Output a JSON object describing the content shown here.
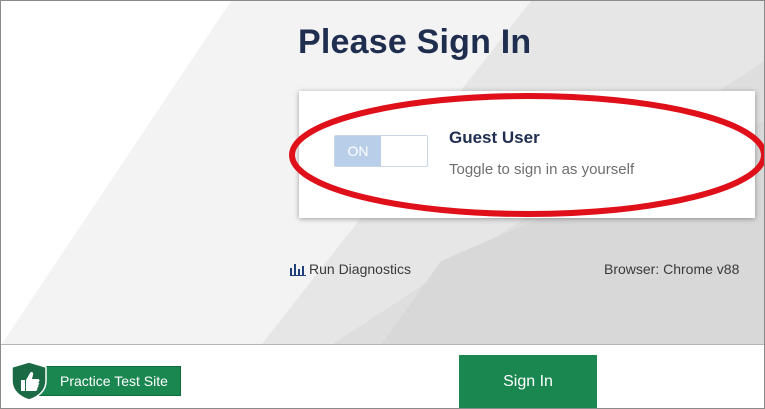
{
  "header": {
    "title": "Please Sign In"
  },
  "guest": {
    "toggle_state": "ON",
    "title": "Guest User",
    "subtitle": "Toggle to sign in as yourself"
  },
  "diagnostics": {
    "label": "Run Diagnostics",
    "icon": "bar-chart-icon"
  },
  "browser_info": "Browser: Chrome v88",
  "footer": {
    "practice_label": "Practice Test Site",
    "practice_icon": "thumbs-up-shield-icon",
    "signin_label": "Sign In"
  },
  "colors": {
    "title": "#1f2d4f",
    "primary_green": "#1a8650",
    "toggle_on": "#b9cfe9",
    "annotation_red": "#e0101a"
  }
}
